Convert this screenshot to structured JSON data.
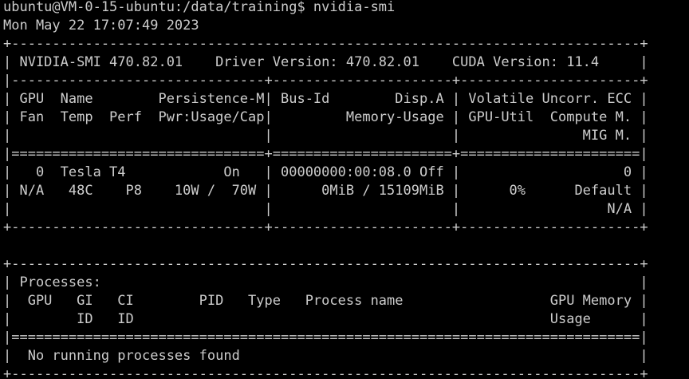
{
  "terminal": {
    "lines": [
      "ubuntu@VM-0-15-ubuntu:/data/training$ nvidia-smi",
      "Mon May 22 17:07:49 2023",
      "+-----------------------------------------------------------------------------+",
      "| NVIDIA-SMI 470.82.01    Driver Version: 470.82.01    CUDA Version: 11.4     |",
      "|-------------------------------+----------------------+----------------------+",
      "| GPU  Name        Persistence-M| Bus-Id        Disp.A | Volatile Uncorr. ECC |",
      "| Fan  Temp  Perf  Pwr:Usage/Cap|         Memory-Usage | GPU-Util  Compute M. |",
      "|                               |                      |               MIG M. |",
      "|===============================+======================+======================|",
      "|   0  Tesla T4            On   | 00000000:00:08.0 Off |                    0 |",
      "| N/A   48C    P8    10W /  70W |      0MiB / 15109MiB |      0%      Default |",
      "|                               |                      |                  N/A |",
      "+-------------------------------+----------------------+----------------------+",
      "",
      "+-----------------------------------------------------------------------------+",
      "| Processes:                                                                  |",
      "|  GPU   GI   CI        PID   Type   Process name                  GPU Memory |",
      "|        ID   ID                                                   Usage      |",
      "|=============================================================================|",
      "|  No running processes found                                                 |",
      "+-----------------------------------------------------------------------------+"
    ]
  }
}
